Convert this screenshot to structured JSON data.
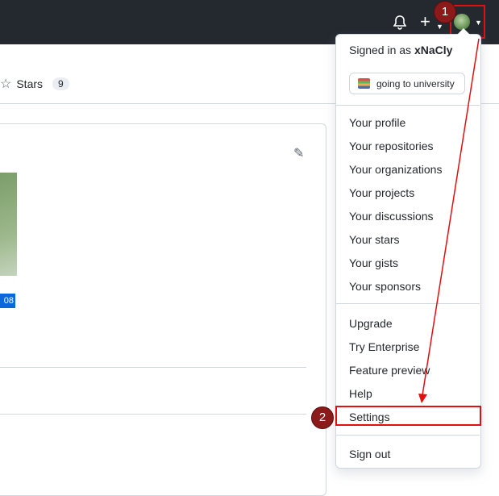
{
  "header": {
    "icons": [
      "bell-icon",
      "plus-icon",
      "avatar"
    ]
  },
  "repo_tabs": {
    "stars_label": "Stars",
    "stars_count": "9"
  },
  "profile_card": {
    "badge_text": "08"
  },
  "user_menu": {
    "signed_in_prefix": "Signed in as",
    "username": "xNaCly",
    "status_text": "going to university",
    "group1": [
      "Your profile",
      "Your repositories",
      "Your organizations",
      "Your projects",
      "Your discussions",
      "Your stars",
      "Your gists",
      "Your sponsors"
    ],
    "group2": [
      "Upgrade",
      "Try Enterprise",
      "Feature preview",
      "Help",
      "Settings"
    ],
    "sign_out": "Sign out"
  },
  "annotations": {
    "step1": "1",
    "step2": "2",
    "highlight_color": "#e01010"
  }
}
